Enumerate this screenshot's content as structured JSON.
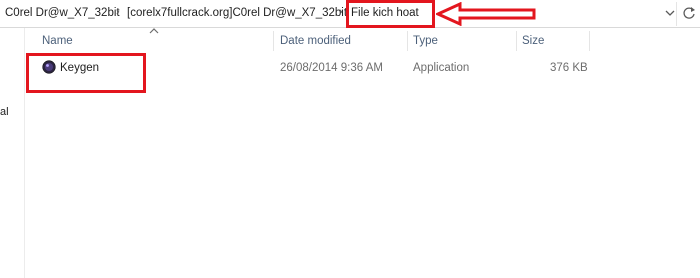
{
  "address": {
    "breadcrumbs": [
      "C0rel Dr@w_X7_32bit",
      "[corelx7fullcrack.org]C0rel Dr@w_X7_32bit"
    ],
    "current": "File kich hoat",
    "separator": "›"
  },
  "nav": {
    "fragment": "al"
  },
  "columns": [
    "Name",
    "Date modified",
    "Type",
    "Size"
  ],
  "files": [
    {
      "name": "Keygen",
      "date_modified": "26/08/2014 9:36 AM",
      "type": "Application",
      "size": "376 KB",
      "icon": "keygen-app-icon"
    }
  ],
  "colors": {
    "annotation": "#e3161e",
    "header_text": "#4c607a",
    "secondary_text": "#6d6d6d"
  }
}
